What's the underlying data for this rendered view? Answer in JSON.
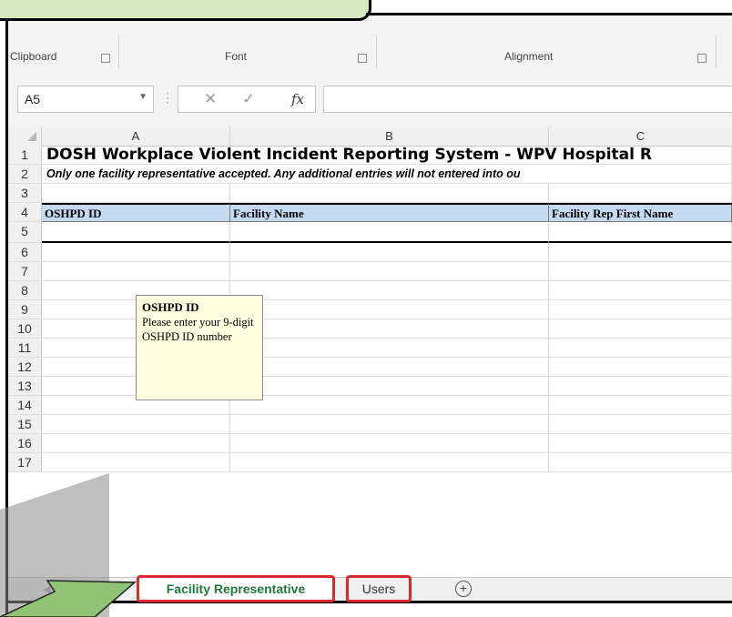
{
  "ribbon": {
    "groups": [
      {
        "label": "Clipboard"
      },
      {
        "label": "Font"
      },
      {
        "label": "Alignment"
      }
    ]
  },
  "formula_bar": {
    "name_box": "A5",
    "fx_symbol": "fx",
    "formula": ""
  },
  "columns": [
    "A",
    "B",
    "C"
  ],
  "rows": [
    "1",
    "2",
    "3",
    "4",
    "5",
    "6",
    "7",
    "8",
    "9",
    "10",
    "11",
    "12",
    "13",
    "14",
    "15",
    "16",
    "17"
  ],
  "sheet": {
    "title": "DOSH Workplace Violent Incident Reporting System - WPV Hospital R",
    "note": "Only one facility representative accepted.  Any additional entries will not entered into ou",
    "headers": [
      "OSHPD ID",
      "Facility Name",
      "Facility Rep First Name"
    ]
  },
  "comment": {
    "title": "OSHPD ID",
    "body": "Please enter your 9-digit OSHPD ID number"
  },
  "tabs": {
    "active": "Facility Representative",
    "second": "Users",
    "add": "+"
  },
  "colors": {
    "callout_green": "#d6e8c2",
    "header_blue": "#c5d9f1",
    "highlight_red": "#d92b2b",
    "tab_text_green": "#1f7a3a",
    "comment_yellow": "#ffffe1"
  }
}
